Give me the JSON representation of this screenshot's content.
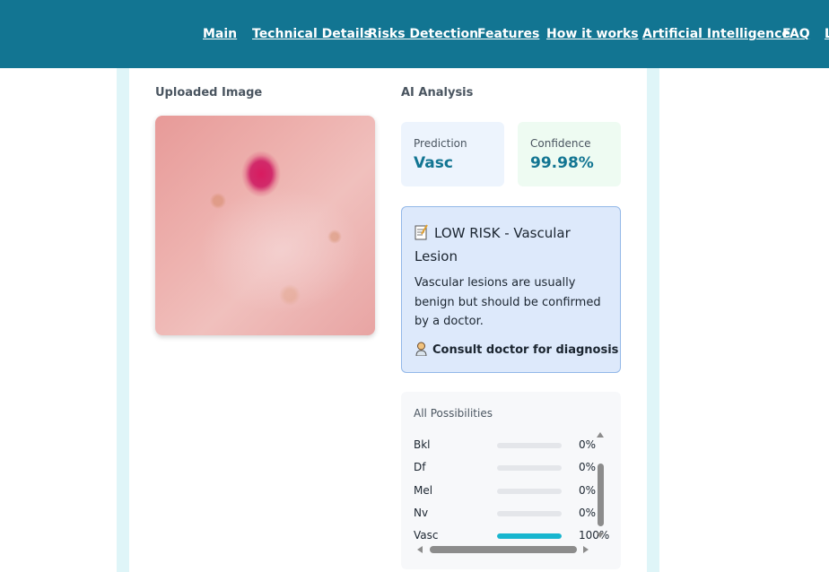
{
  "nav": {
    "links": [
      "Main",
      "Technical Details",
      "Risks Detection",
      "Features",
      "How it works",
      "Artificial Intelligence",
      "FAQ",
      "L"
    ]
  },
  "upload": {
    "title": "Uploaded Image"
  },
  "analysis": {
    "title": "AI Analysis",
    "prediction_label": "Prediction",
    "prediction_value": "Vasc",
    "confidence_label": "Confidence",
    "confidence_value": "99.98%"
  },
  "risk": {
    "icon": "memo-icon",
    "title": "LOW RISK - Vascular Lesion",
    "description": "Vascular lesions are usually benign but should be confirmed by a doctor.",
    "action_icon": "doctor-icon",
    "action": "Consult doctor for diagnosis"
  },
  "possibilities": {
    "title": "All Possibilities",
    "items": [
      {
        "name": "Bkl",
        "value": 0,
        "label": "0%"
      },
      {
        "name": "Df",
        "value": 0,
        "label": "0%"
      },
      {
        "name": "Mel",
        "value": 0,
        "label": "0%"
      },
      {
        "name": "Nv",
        "value": 0,
        "label": "0%"
      },
      {
        "name": "Vasc",
        "value": 100,
        "label": "100%"
      }
    ]
  },
  "colors": {
    "header": "#127592",
    "accent": "#17b6cf",
    "risk_bg": "#dde9fb",
    "confidence_bg": "#eefbf2",
    "prediction_bg": "#edf4fd"
  }
}
